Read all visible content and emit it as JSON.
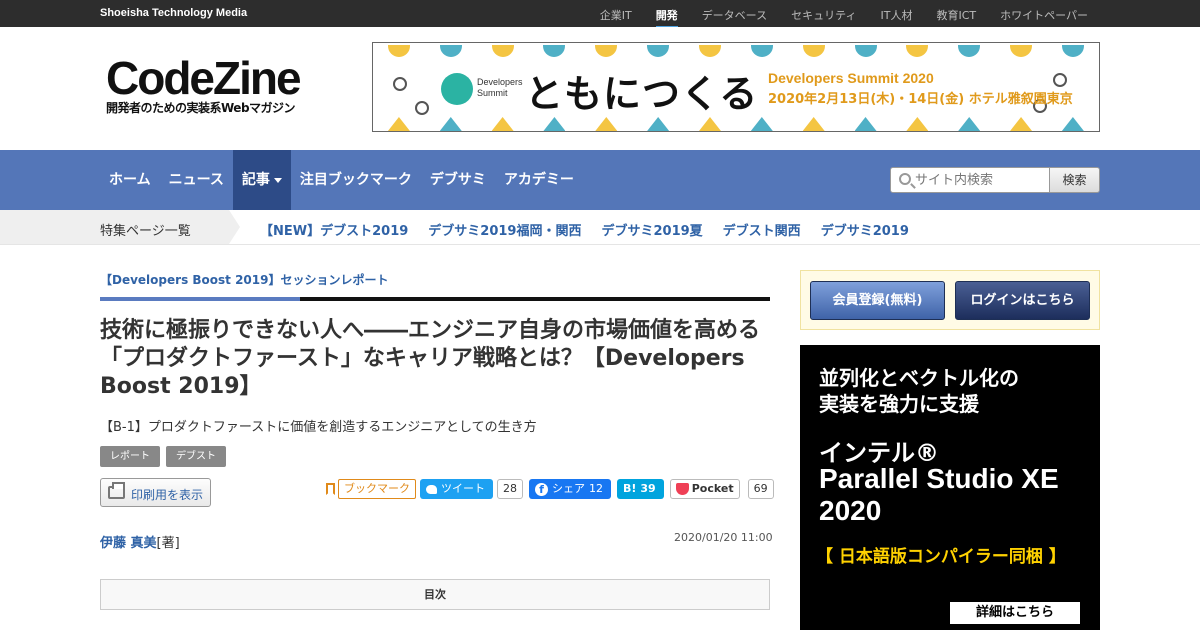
{
  "topbar": {
    "brand": "Shoeisha Technology Media",
    "nav": [
      "企業IT",
      "開発",
      "データベース",
      "セキュリティ",
      "IT人材",
      "教育ICT",
      "ホワイトペーパー"
    ],
    "active": "開発"
  },
  "logo": {
    "main": "CodeZine",
    "sub": "開発者のための実装系Webマガジン"
  },
  "banner": {
    "brand_line1": "Developers",
    "brand_line2": "Summit",
    "headline": "ともにつくる",
    "event": "Developers Summit 2020",
    "dates": "2020年2月13日(木)・14日(金) ホテル雅叙園東京"
  },
  "mainnav": {
    "items": [
      "ホーム",
      "ニュース",
      "記事",
      "注目ブックマーク",
      "デブサミ",
      "アカデミー"
    ],
    "active": "記事",
    "search_placeholder": "サイト内検索",
    "search_button": "検索"
  },
  "subnav": {
    "label": "特集ページ一覧",
    "links": [
      "【NEW】デブスト2019",
      "デブサミ2019福岡・関西",
      "デブサミ2019夏",
      "デブスト関西",
      "デブサミ2019"
    ]
  },
  "article": {
    "category": "【Developers Boost 2019】セッションレポート",
    "title": "技術に極振りできない人へ――エンジニア自身の市場価値を高める「プロダクトファースト」なキャリア戦略とは？【Developers Boost 2019】",
    "subtitle": "【B-1】プロダクトファーストに価値を創造するエンジニアとしての生き方",
    "tags": [
      "レポート",
      "デブスト"
    ],
    "print_label": "印刷用を表示",
    "author": "伊藤 真美",
    "author_role": "[著]",
    "date": "2020/01/20 11:00",
    "toc_label": "目次"
  },
  "share": {
    "bookmark_label": "ブックマーク",
    "tweet_label": "ツイート",
    "tweet_count": "28",
    "fb_label": "シェア",
    "fb_count": "12",
    "hatena_label": "B!",
    "hatena_count": "39",
    "pocket_label": "Pocket",
    "pocket_count": "69"
  },
  "sidebar": {
    "register_label": "会員登録(無料)",
    "login_label": "ログインはこちら",
    "ad": {
      "line1": "並列化とベクトル化の",
      "line2": "実装を強力に支援",
      "line3": "インテル®",
      "line4": "Parallel Studio XE 2020",
      "line5": "【 日本語版コンパイラー同梱 】",
      "cta": "詳細はこちら"
    }
  },
  "colors": {
    "nav_bg": "#5476b8",
    "nav_active": "#2d4b87",
    "link": "#2f62a6",
    "accent": "#e09a1b"
  }
}
